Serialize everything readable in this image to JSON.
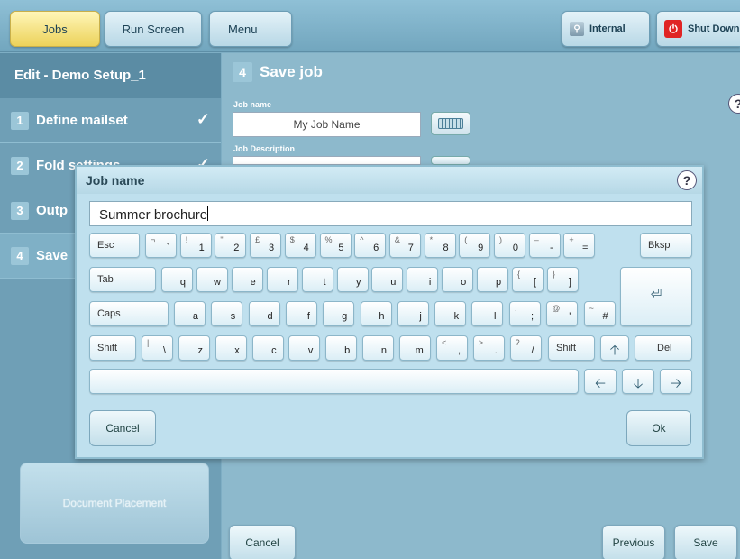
{
  "topbar": {
    "jobs": "Jobs",
    "run_screen": "Run Screen",
    "menu": "Menu",
    "internal": "Internal",
    "shut_down": "Shut Down"
  },
  "sidebar": {
    "title": "Edit - Demo Setup_1",
    "steps": [
      {
        "num": "1",
        "label": "Define mailset",
        "done": true
      },
      {
        "num": "2",
        "label": "Fold settings",
        "done": true
      },
      {
        "num": "3",
        "label": "Outp",
        "done": false
      },
      {
        "num": "4",
        "label": "Save",
        "done": false
      }
    ],
    "document_placement": "Document Placement"
  },
  "main": {
    "step_num": "4",
    "title": "Save job",
    "job_name_label": "Job name",
    "job_name_value": "My Job Name",
    "job_desc_label": "Job Description",
    "cancel": "Cancel",
    "previous": "Previous",
    "save": "Save"
  },
  "dialog": {
    "title": "Job name",
    "help": "?",
    "input_value": "Summer brochure",
    "cancel": "Cancel",
    "ok": "Ok",
    "keys": {
      "esc": "Esc",
      "bksp": "Bksp",
      "tab": "Tab",
      "caps": "Caps",
      "shift": "Shift",
      "del": "Del",
      "row1": [
        {
          "sh": "¬",
          "nm": "`"
        },
        {
          "sh": "!",
          "nm": "1"
        },
        {
          "sh": "\"",
          "nm": "2"
        },
        {
          "sh": "£",
          "nm": "3"
        },
        {
          "sh": "$",
          "nm": "4"
        },
        {
          "sh": "%",
          "nm": "5"
        },
        {
          "sh": "^",
          "nm": "6"
        },
        {
          "sh": "&",
          "nm": "7"
        },
        {
          "sh": "*",
          "nm": "8"
        },
        {
          "sh": "(",
          "nm": "9"
        },
        {
          "sh": ")",
          "nm": "0"
        },
        {
          "sh": "–",
          "nm": "-"
        },
        {
          "sh": "+",
          "nm": "="
        }
      ],
      "row2": [
        "q",
        "w",
        "e",
        "r",
        "t",
        "y",
        "u",
        "i",
        "o",
        "p"
      ],
      "row2_extra": [
        {
          "sh": "{",
          "nm": "["
        },
        {
          "sh": "}",
          "nm": "]"
        }
      ],
      "row3": [
        "a",
        "s",
        "d",
        "f",
        "g",
        "h",
        "j",
        "k",
        "l"
      ],
      "row3_extra": [
        {
          "sh": ":",
          "nm": ";"
        },
        {
          "sh": "@",
          "nm": "'"
        },
        {
          "sh": "~",
          "nm": "#"
        }
      ],
      "row4_extra_l": [
        {
          "sh": "|",
          "nm": "\\"
        }
      ],
      "row4": [
        "z",
        "x",
        "c",
        "v",
        "b",
        "n",
        "m"
      ],
      "row4_extra_r": [
        {
          "sh": "<",
          "nm": ","
        },
        {
          "sh": ">",
          "nm": "."
        },
        {
          "sh": "?",
          "nm": "/"
        }
      ]
    }
  },
  "icons": {
    "check": "✓",
    "up": "🡡",
    "down": "🡣",
    "left": "🡠",
    "right": "🡢",
    "enter": "⏎"
  }
}
